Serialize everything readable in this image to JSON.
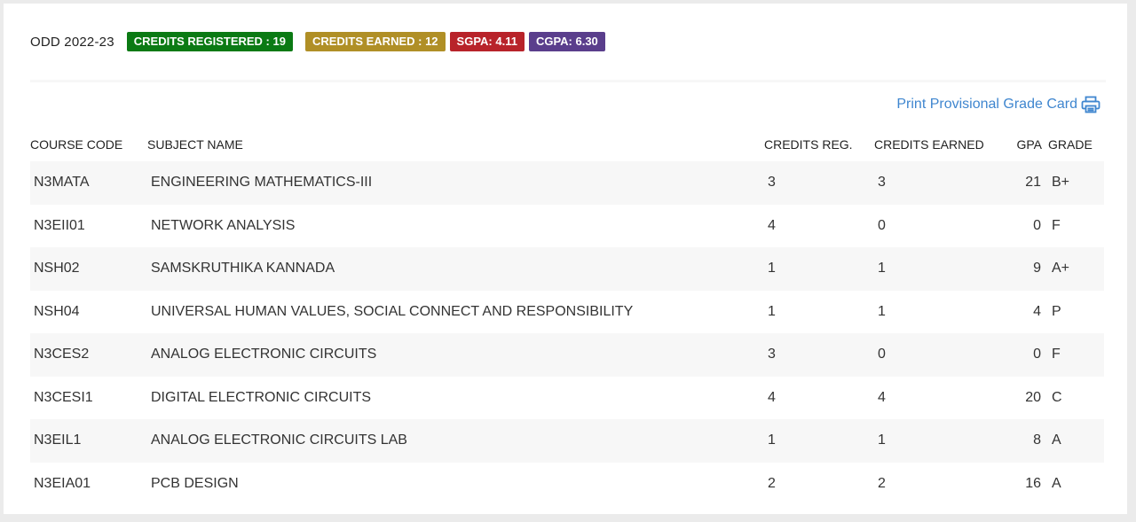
{
  "semester": {
    "label": "ODD 2022-23",
    "badges": [
      {
        "text": "CREDITS REGISTERED : 19",
        "color": "#0b7a14"
      },
      {
        "text": "CREDITS EARNED : 12",
        "color": "#b08f26"
      },
      {
        "text": "SGPA: 4.11",
        "color": "#b8232a"
      },
      {
        "text": "CGPA: 6.30",
        "color": "#5a3e8c"
      }
    ]
  },
  "print_link": {
    "label": "Print Provisional Grade Card",
    "icon": "printer-icon",
    "color": "#3f86cf"
  },
  "table": {
    "headers": {
      "course_code": "COURSE CODE",
      "subject_name": "SUBJECT NAME",
      "credits_reg": "CREDITS REG.",
      "credits_earned": "CREDITS EARNED",
      "gpa": "GPA",
      "grade": "GRADE"
    },
    "rows": [
      {
        "course_code": "N3MATA",
        "subject_name": "ENGINEERING MATHEMATICS-III",
        "credits_reg": "3",
        "credits_earned": "3",
        "gpa": "21",
        "grade": "B+"
      },
      {
        "course_code": "N3EII01",
        "subject_name": "NETWORK ANALYSIS",
        "credits_reg": "4",
        "credits_earned": "0",
        "gpa": "0",
        "grade": "F"
      },
      {
        "course_code": "NSH02",
        "subject_name": "SAMSKRUTHIKA KANNADA",
        "credits_reg": "1",
        "credits_earned": "1",
        "gpa": "9",
        "grade": "A+"
      },
      {
        "course_code": "NSH04",
        "subject_name": "UNIVERSAL HUMAN VALUES, SOCIAL CONNECT AND RESPONSIBILITY",
        "credits_reg": "1",
        "credits_earned": "1",
        "gpa": "4",
        "grade": "P"
      },
      {
        "course_code": "N3CES2",
        "subject_name": "ANALOG ELECTRONIC CIRCUITS",
        "credits_reg": "3",
        "credits_earned": "0",
        "gpa": "0",
        "grade": "F"
      },
      {
        "course_code": "N3CESI1",
        "subject_name": "DIGITAL ELECTRONIC CIRCUITS",
        "credits_reg": "4",
        "credits_earned": "4",
        "gpa": "20",
        "grade": "C"
      },
      {
        "course_code": "N3EIL1",
        "subject_name": "ANALOG ELECTRONIC CIRCUITS LAB",
        "credits_reg": "1",
        "credits_earned": "1",
        "gpa": "8",
        "grade": "A"
      },
      {
        "course_code": "N3EIA01",
        "subject_name": "PCB DESIGN",
        "credits_reg": "2",
        "credits_earned": "2",
        "gpa": "16",
        "grade": "A"
      }
    ]
  }
}
